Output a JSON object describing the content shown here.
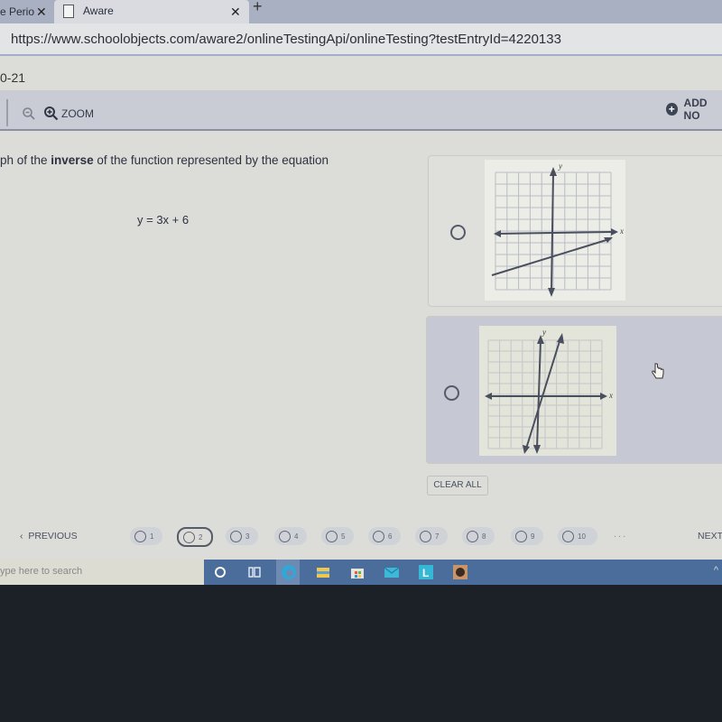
{
  "browser": {
    "tabs": [
      {
        "title": "e Perio",
        "active": false
      },
      {
        "title": "Aware",
        "active": true
      }
    ],
    "url": "https://www.schoolobjects.com/aware2/onlineTestingApi/onlineTesting?testEntryId=4220133"
  },
  "page": {
    "breadcrumb": "0-21",
    "toolbar": {
      "zoom_label": "ZOOM",
      "add_note_label": "ADD NO"
    },
    "question": {
      "prompt_prefix": "ph of the ",
      "prompt_bold": "inverse",
      "prompt_suffix": " of the function represented by the equation",
      "equation": "y = 3x + 6"
    },
    "options": [
      {
        "id": "A",
        "selected": false,
        "graph": {
          "x_label": "x",
          "y_label": "y",
          "lines": [
            {
              "description": "line with slope 1/3, y-intercept -2"
            }
          ]
        }
      },
      {
        "id": "B",
        "selected": false,
        "graph": {
          "x_label": "x",
          "y_label": "y",
          "lines": [
            {
              "description": "steep line with slope 3"
            }
          ]
        }
      }
    ],
    "clear_all_label": "CLEAR ALL",
    "pager": {
      "previous_label": "PREVIOUS",
      "next_label": "NEXT",
      "current": 2,
      "pages": [
        "1",
        "2",
        "3",
        "4",
        "5",
        "6",
        "7",
        "8",
        "9",
        "10"
      ],
      "more": "..."
    }
  },
  "taskbar": {
    "search_placeholder": "ype here to search",
    "icons": [
      "cortana-icon",
      "task-view-icon",
      "edge-icon",
      "file-explorer-icon",
      "store-icon",
      "mail-icon",
      "l-app-icon",
      "app-icon"
    ]
  }
}
